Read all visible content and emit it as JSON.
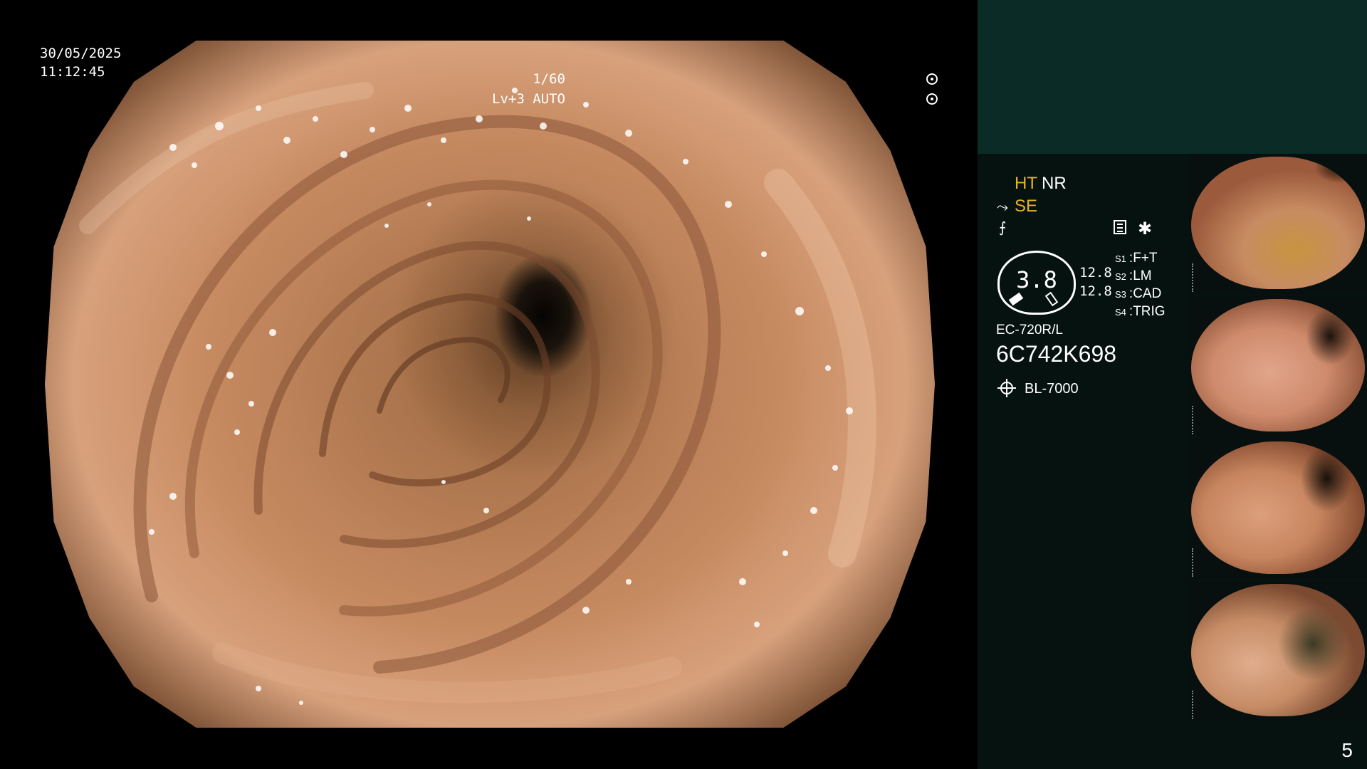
{
  "overlay": {
    "date": "30/05/2025",
    "time": "11:12:45",
    "shutter": "1/60",
    "level": "Lv+3 AUTO"
  },
  "panel": {
    "ht": "HT",
    "nr": "NR",
    "se": "SE",
    "gauge_value": "3.8",
    "readout_1": "12.8",
    "readout_2": "12.8",
    "switches": [
      {
        "id": "S1",
        "label": "F+T"
      },
      {
        "id": "S2",
        "label": "LM"
      },
      {
        "id": "S3",
        "label": "CAD"
      },
      {
        "id": "S4",
        "label": "TRIG"
      }
    ],
    "scope_model": "EC-720R/L",
    "serial": "6C742K698",
    "light_source": "BL-7000",
    "colors": {
      "accent": "#e8b324",
      "header": "#0b2b26",
      "panel": "#061210"
    }
  },
  "thumbnails": [
    "t1",
    "t2",
    "t3",
    "t4"
  ],
  "page_number": "5"
}
